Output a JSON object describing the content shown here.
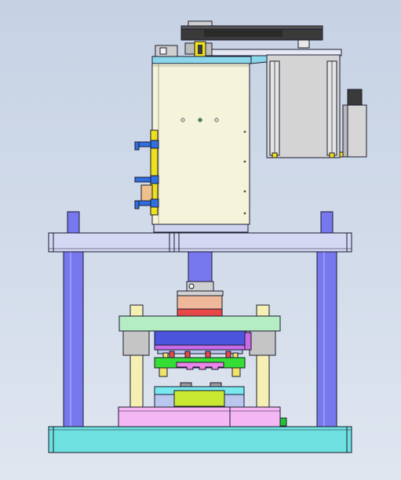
{
  "viewport": {
    "background_top": "#c6d2e4",
    "background_bottom": "#e0e6f0"
  },
  "colors": {
    "outline": "#1b1b2e",
    "column_blue": "#7777ee",
    "plate_lavender": "#d4d8f2",
    "cabinet_cream": "#f5f4da",
    "cabinet_top_cyan": "#8bd6ea",
    "bracket_blue": "#2f6fe0",
    "clamp_yellow": "#ede01c",
    "servo_gray": "#d4d4d4",
    "servo_dark": "#3a3a3a",
    "beam_dark": "#2e2e2e",
    "guide_post_cream": "#f5efb4",
    "bushing_gray": "#c5c5c5",
    "die_top_green": "#b4ecc4",
    "punch_holder_salmon": "#f0b89a",
    "punch_holder_red": "#e84848",
    "upper_pad_blue": "#4b54dc",
    "stripper_green": "#35de35",
    "stripper_pink": "#ea86ea",
    "die_block_cyan": "#7ae8f0",
    "die_insert_lime": "#c8e832",
    "lower_plate_pink": "#f4b6f4",
    "base_cyan": "#6ee0e0",
    "indicator_green": "#22c433"
  }
}
